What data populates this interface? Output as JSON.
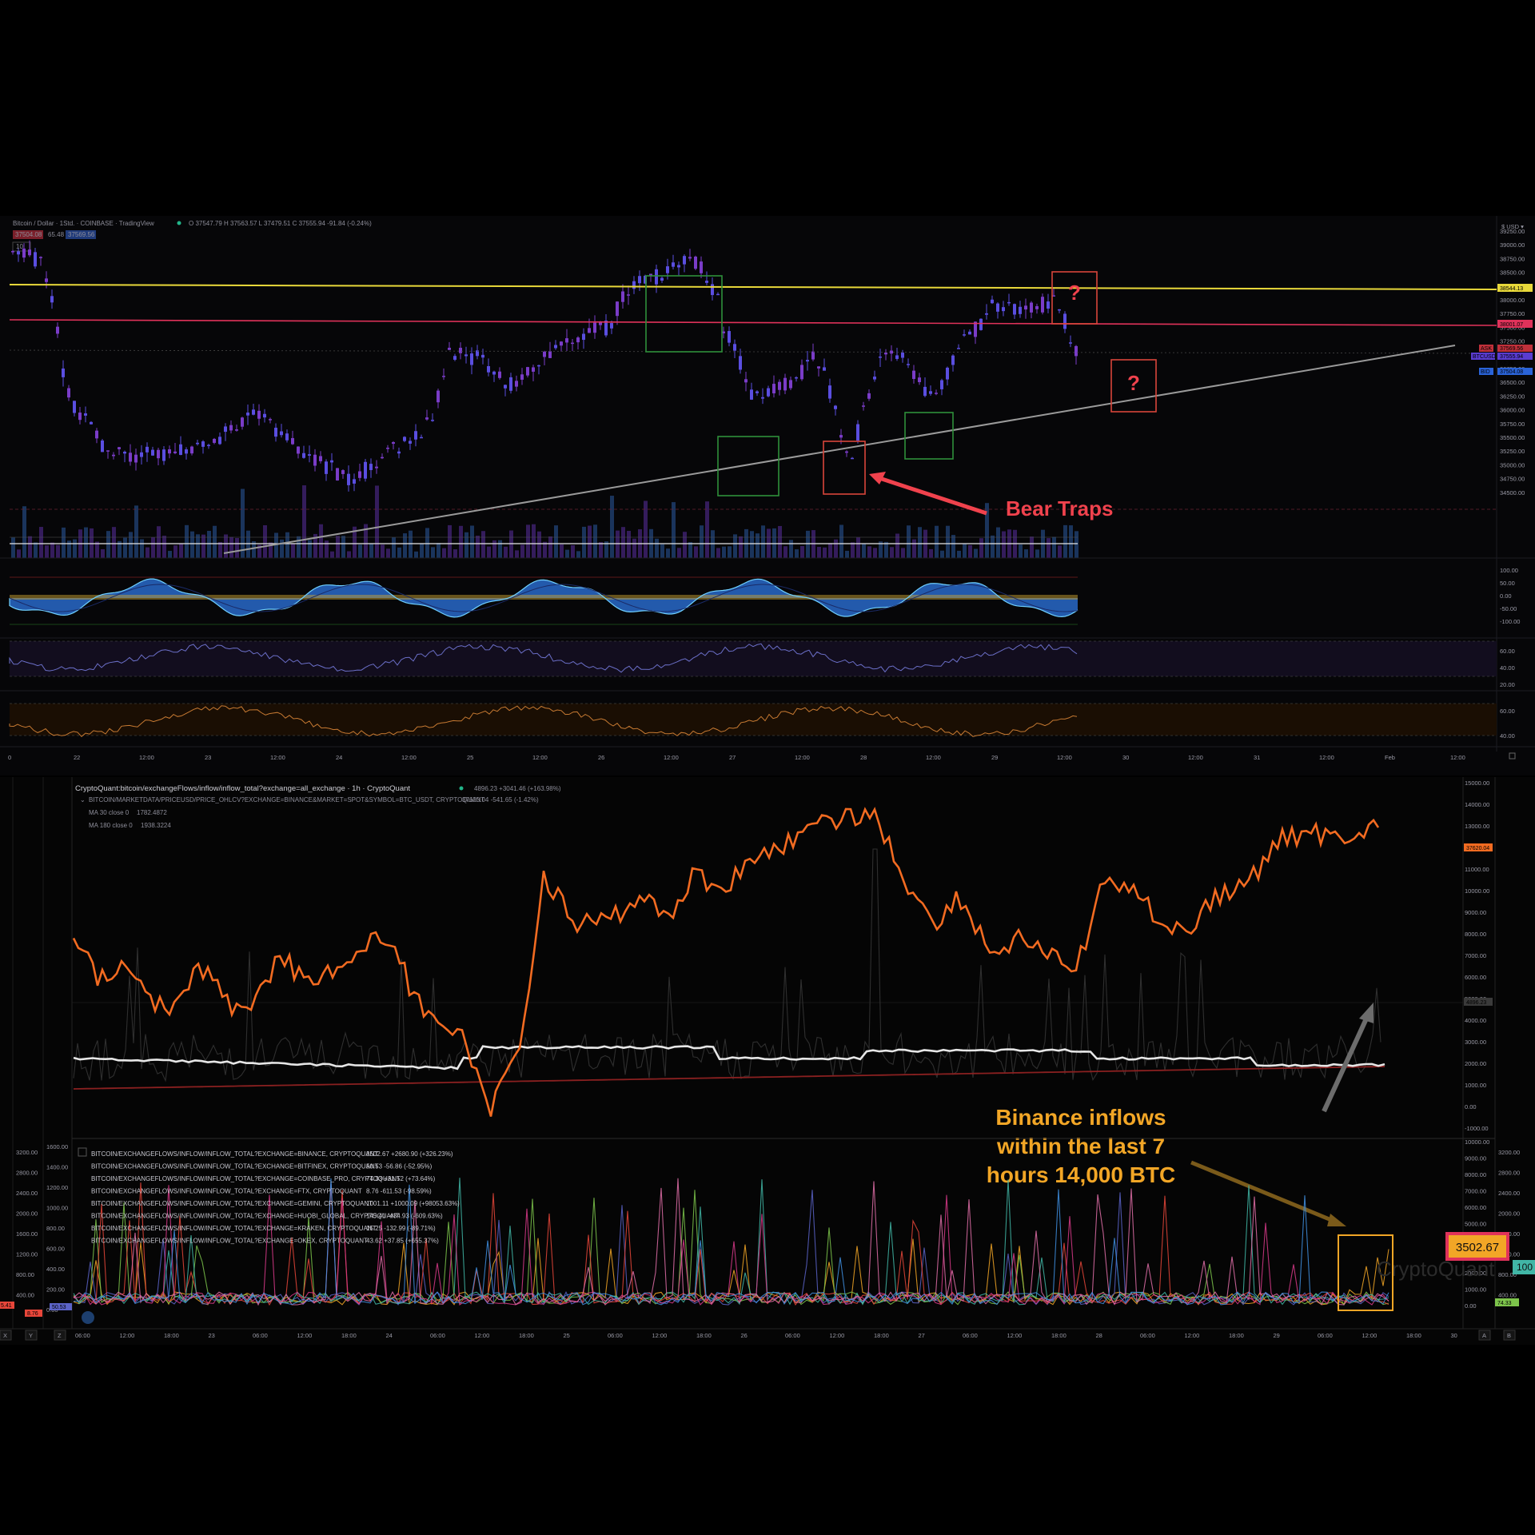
{
  "tradingview": {
    "title": "Bitcoin / Dollar · 1Std. · COINBASE · TradingView",
    "ohlc": "O 37547.79  H 37563.57  L 37479.51  C 37555.94  -91.84 (-0.24%)",
    "price_badge_left": "37504.08",
    "spread": "65.48",
    "price_badge_right": "37569.56",
    "indicator_count": "10",
    "currency": "$ USD ▾",
    "y_labels": [
      "39250.00",
      "39000.00",
      "38750.00",
      "38500.00",
      "38250.00",
      "38000.00",
      "37750.00",
      "37500.00",
      "37250.00",
      "37000.00",
      "36750.00",
      "36500.00",
      "36250.00",
      "36000.00",
      "35750.00",
      "35500.00",
      "35250.00",
      "35000.00",
      "34750.00",
      "34500.00"
    ],
    "price_tags": {
      "yellow": "38544.13",
      "red": "38001.07",
      "ask_label": "ASK",
      "ask": "37569.56",
      "btc_label": "BTCUSD",
      "btc": "37555.94",
      "vol": "52:29",
      "bid_label": "BID",
      "bid": "37504.08"
    },
    "osc_labels": [
      "100.00",
      "50.00",
      "0.00",
      "-50.00",
      "-100.00"
    ],
    "rsi_labels": [
      "60.00",
      "40.00",
      "20.00"
    ],
    "stoch_labels": [
      "60.00",
      "40.00"
    ],
    "x_labels": [
      "0",
      "22",
      "12:00",
      "23",
      "12:00",
      "24",
      "12:00",
      "25",
      "12:00",
      "26",
      "12:00",
      "27",
      "12:00",
      "28",
      "12:00",
      "29",
      "12:00",
      "30",
      "12:00",
      "31",
      "12:00",
      "Feb",
      "12:00"
    ]
  },
  "annotations": {
    "bear_traps": "Bear Traps",
    "question": "?",
    "binance_line1": "Binance inflows",
    "binance_line2": "within the last 7",
    "binance_line3": "hours 14,000 BTC"
  },
  "cryptoquant": {
    "header": "CryptoQuant:bitcoin/exchangeFlows/inflow/inflow_total?exchange=all_exchange · 1h · CryptoQuant",
    "header_values": "4896.23  +3041.46 (+163.98%)",
    "price_series": "BITCOIN/MARKETDATA/PRICEUSD/PRICE_OHLCV?EXCHANGE=BINANCE&MARKET=SPOT&SYMBOL=BTC_USDT, CRYPTOQUANT",
    "price_values": "37620.04  -541.65 (-1.42%)",
    "ma30": "MA 30 close 0",
    "ma30_val": "1782.4872",
    "ma180": "MA 180 close 0",
    "ma180_val": "1938.3224",
    "top_y_labels": [
      "15000.00",
      "14000.00",
      "13000.00",
      "12000.00",
      "11000.00",
      "10000.00",
      "9000.00",
      "8000.00",
      "7000.00",
      "6000.00",
      "5000.00",
      "4000.00",
      "3000.00",
      "2000.00",
      "1000.00",
      "0.00",
      "-1000.00"
    ],
    "price_tag": "37620.04",
    "inflow_tag": "4896.23",
    "bottom_y_labels": [
      "10000.00",
      "9000.00",
      "8000.00",
      "7000.00",
      "6000.00",
      "5000.00",
      "4000.00",
      "3000.00",
      "2000.00",
      "1000.00",
      "0.00"
    ],
    "bottom_left_y_labels": [
      "1600.00",
      "1400.00",
      "1200.00",
      "1000.00",
      "800.00",
      "600.00",
      "400.00",
      "200.00",
      "0.00"
    ],
    "far_left_y_labels": [
      "3200.00",
      "2800.00",
      "2400.00",
      "2000.00",
      "1600.00",
      "1200.00",
      "800.00",
      "400.00"
    ],
    "right_mid_y_labels": [
      "3200.00",
      "2800.00",
      "2400.00",
      "2000.00",
      "1600.00",
      "1200.00",
      "800.00",
      "400.00"
    ],
    "binance_tag": "3502.67",
    "tag_bottom_left_a": "5.41",
    "tag_bottom_left_b": "8.76",
    "tag_bottom_left_c": "50.53",
    "tag_right_green": "74.33",
    "tag_right_teal": "100",
    "watermark": "CryptoQuant",
    "exchanges": [
      {
        "name": "BITCOIN/EXCHANGEFLOWS/INFLOW/INFLOW_TOTAL?EXCHANGE=BINANCE, CRYPTOQUANT",
        "vals": "3502.67  +2680.90 (+326.23%)",
        "color": "#f2a626"
      },
      {
        "name": "BITCOIN/EXCHANGEFLOWS/INFLOW/INFLOW_TOTAL?EXCHANGE=BITFINEX, CRYPTOQUANT",
        "vals": "50.53  -56.86 (-52.95%)",
        "color": "#5b63c8"
      },
      {
        "name": "BITCOIN/EXCHANGEFLOWS/INFLOW/INFLOW_TOTAL?EXCHANGE=COINBASE_PRO, CRYPTOQUANT",
        "vals": "74.33  +31.52 (+73.64%)",
        "color": "#7dc44b"
      },
      {
        "name": "BITCOIN/EXCHANGEFLOWS/INFLOW/INFLOW_TOTAL?EXCHANGE=FTX, CRYPTOQUANT",
        "vals": "8.76  -611.53 (-98.59%)",
        "color": "#e8463a"
      },
      {
        "name": "BITCOIN/EXCHANGEFLOWS/INFLOW/INFLOW_TOTAL?EXCHANGE=GEMINI, CRYPTOQUANT",
        "vals": "1001.11  +1000.09 (+98053.63%)",
        "color": "#41b6a6"
      },
      {
        "name": "BITCOIN/EXCHANGEFLOWS/INFLOW/INFLOW_TOTAL?EXCHANGE=HUOBI_GLOBAL, CRYPTOQUANT",
        "vals": "145.41  -434.93 (-609.63%)",
        "color": "#d83a8a"
      },
      {
        "name": "BITCOIN/EXCHANGEFLOWS/INFLOW/INFLOW_TOTAL?EXCHANGE=KRAKEN, CRYPTOQUANT",
        "vals": "15.25  -132.99 (-89.71%)",
        "color": "#e06fa8"
      },
      {
        "name": "BITCOIN/EXCHANGEFLOWS/INFLOW/INFLOW_TOTAL?EXCHANGE=OKEX, CRYPTOQUANT",
        "vals": "43.62  +37.85 (+655.37%)",
        "color": "#3f8fe0"
      }
    ],
    "x_labels": [
      "06:00",
      "12:00",
      "18:00",
      "23",
      "06:00",
      "12:00",
      "18:00",
      "24",
      "06:00",
      "12:00",
      "18:00",
      "25",
      "06:00",
      "12:00",
      "18:00",
      "26",
      "06:00",
      "12:00",
      "18:00",
      "27",
      "06:00",
      "12:00",
      "18:00",
      "28",
      "06:00",
      "12:00",
      "18:00",
      "29",
      "06:00",
      "12:00",
      "18:00",
      "30"
    ],
    "corner_labels": [
      "X",
      "Y",
      "Z",
      "A",
      "B"
    ]
  },
  "colors": {
    "yellow_line": "#e8d83a",
    "red_line": "#e0325a",
    "trend_line": "#9a9a9a",
    "candle": "#5a4ee0",
    "candle_b": "#7a3cc8",
    "orange": "#f26b21",
    "ma_white": "#e6e6e6",
    "ma_red": "#8a2020"
  }
}
